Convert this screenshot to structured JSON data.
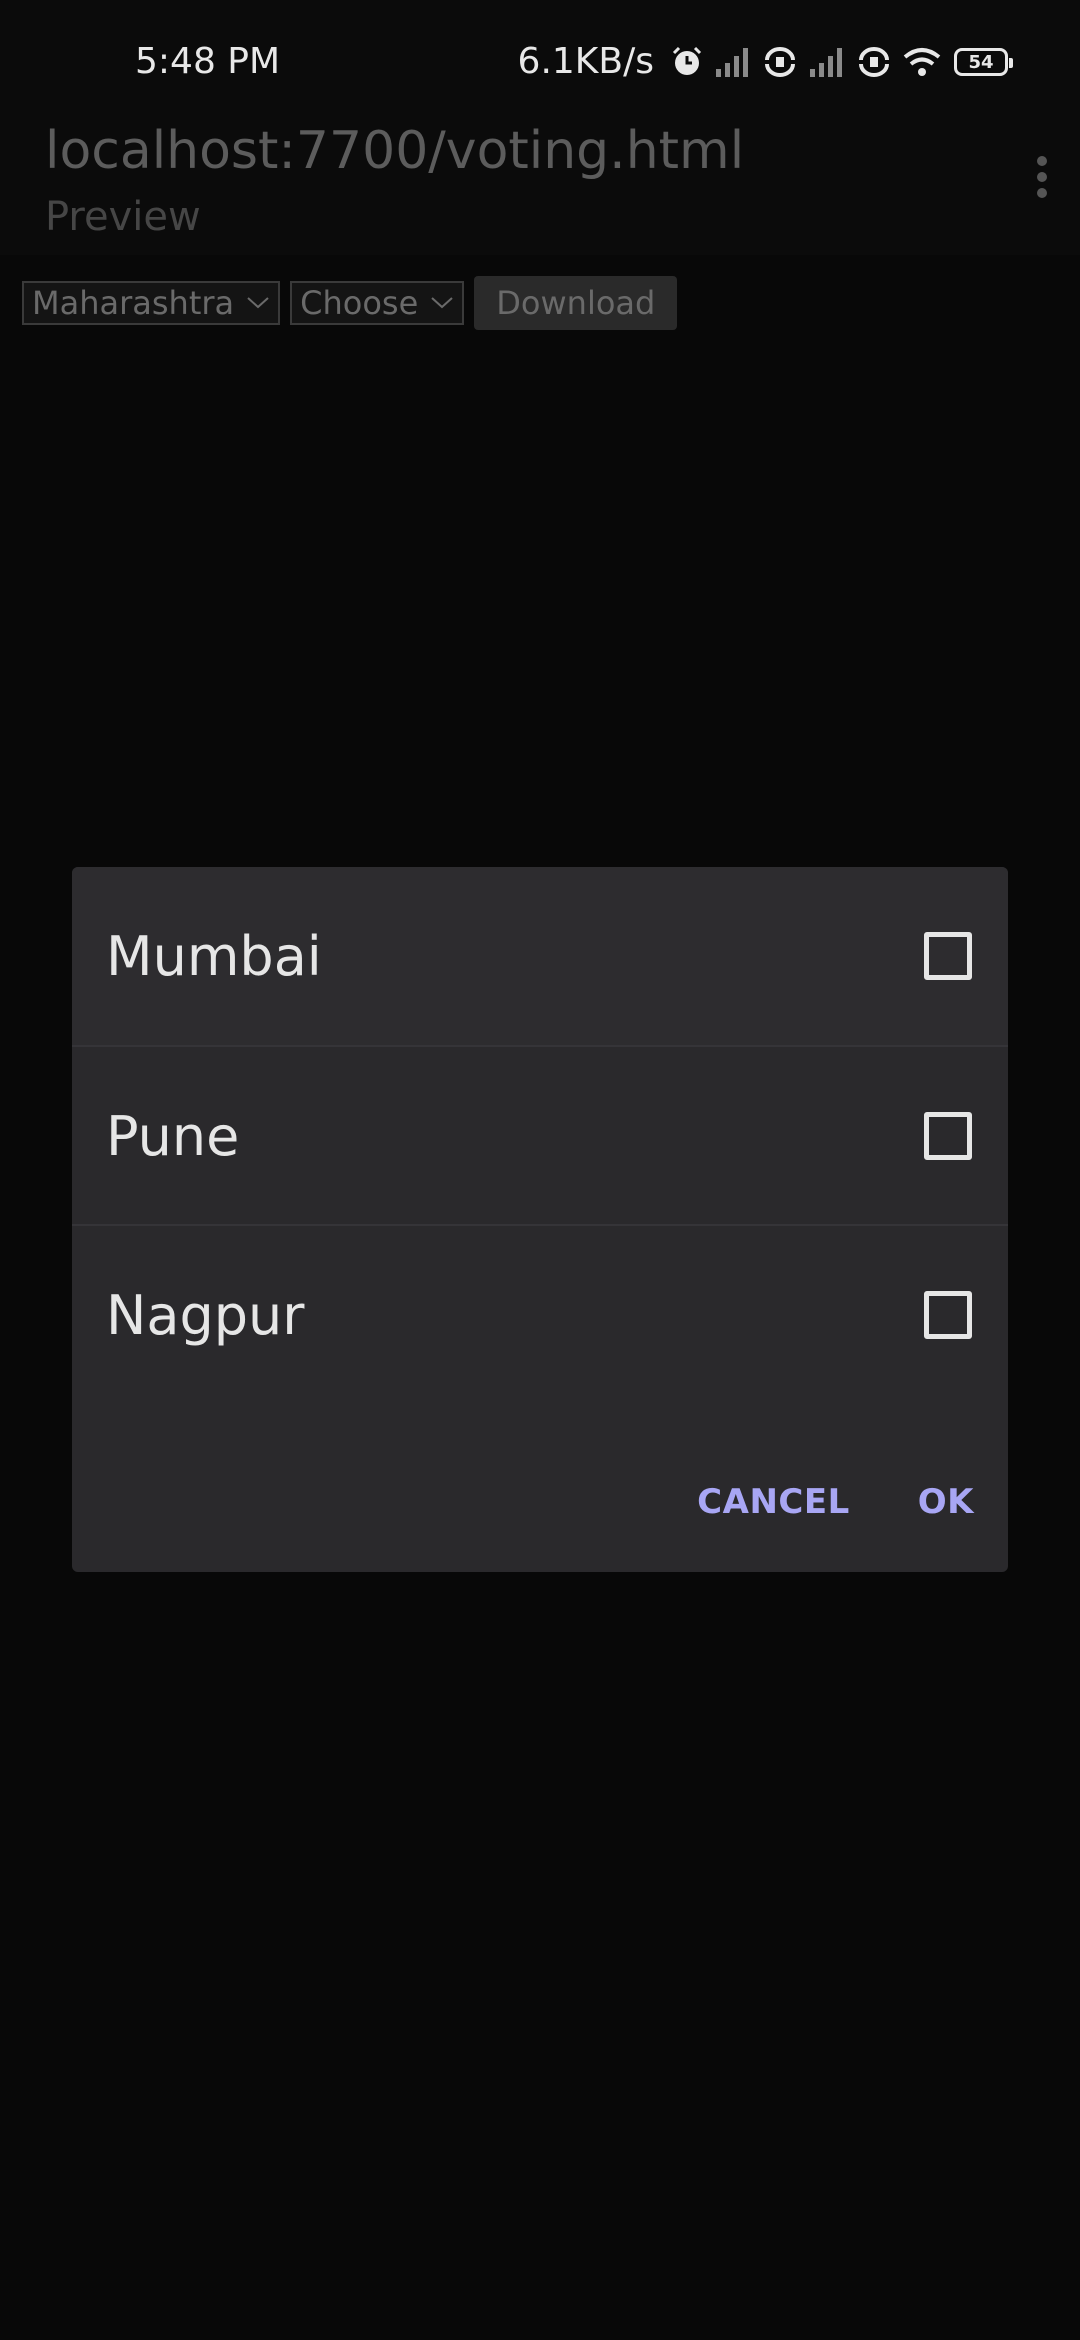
{
  "status_bar": {
    "time": "5:48 PM",
    "network_speed": "6.1KB/s",
    "battery_level": "54",
    "icons": [
      "alarm-icon",
      "signal-icon",
      "sync-icon",
      "signal-icon",
      "sync-icon",
      "wifi-icon",
      "battery-icon"
    ]
  },
  "app_bar": {
    "title": "localhost:7700/voting.html",
    "subtitle": "Preview",
    "menu_icon": "more-vert-icon"
  },
  "toolbar": {
    "state_select": "Maharashtra",
    "city_select": "Choose",
    "download_label": "Download"
  },
  "dialog": {
    "options": [
      {
        "label": "Mumbai",
        "checked": false
      },
      {
        "label": "Pune",
        "checked": false
      },
      {
        "label": "Nagpur",
        "checked": false
      }
    ],
    "cancel_label": "CANCEL",
    "ok_label": "OK"
  },
  "colors": {
    "background": "#080808",
    "dialog_bg": "#2a292c",
    "accent": "#a8a6f4",
    "text_primary": "#e6e6e6",
    "text_dim": "#5c5c5c"
  }
}
